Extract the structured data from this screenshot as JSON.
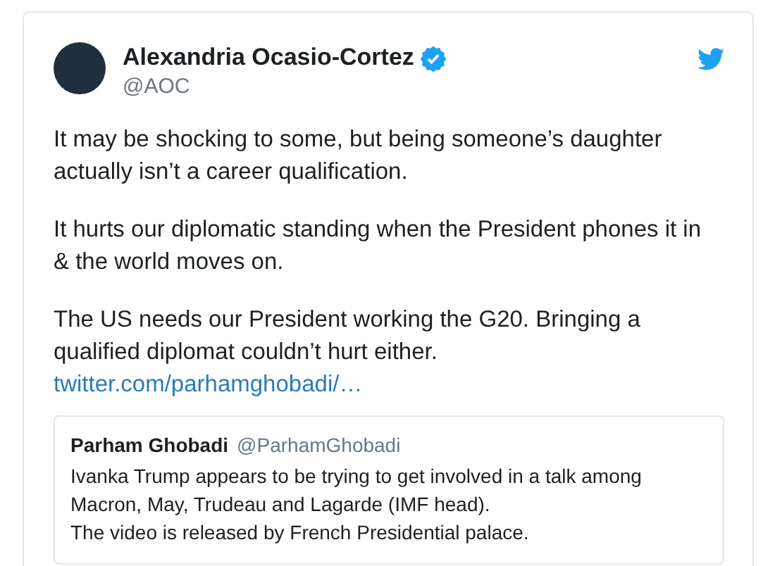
{
  "tweet": {
    "author": {
      "name": "Alexandria Ocasio-Cortez",
      "verified": true,
      "handle": "@AOC"
    },
    "paragraphs": [
      "It may be shocking to some, but being someone’s daughter\nactually isn’t a career qualification.",
      "It hurts our diplomatic standing when the President phones it in\n& the world moves on.",
      "The US needs our President working the G20. Bringing a\nqualified diplomat couldn’t hurt either."
    ],
    "link": "twitter.com/parhamghobadi/…",
    "quoted_tweet": {
      "name": "Parham Ghobadi",
      "handle": "@ParhamGhobadi",
      "text": "Ivanka Trump appears to be trying to get involved in a talk among\nMacron, May, Trudeau and Lagarde (IMF head).\nThe video is released by French Presidential palace."
    }
  }
}
